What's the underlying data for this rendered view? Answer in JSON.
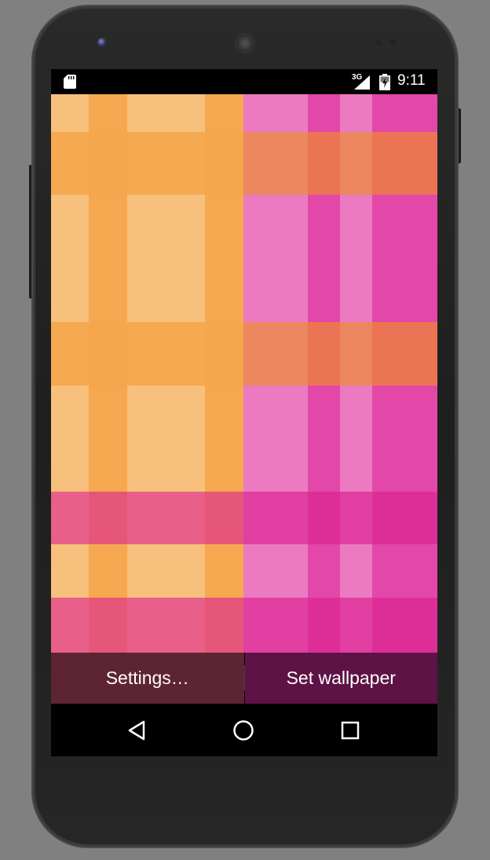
{
  "status_bar": {
    "network": "3G",
    "time": "9:11",
    "icons": [
      "sd-card-icon",
      "signal-icon",
      "battery-icon"
    ]
  },
  "wallpaper": {
    "colors": {
      "orange_light": "#f7c07d",
      "orange": "#f4a64b",
      "orange_dark": "#f29a2e",
      "pink_light": "#ec7ac0",
      "pink": "#e347a8",
      "coral": "#ec8760",
      "rose": "#e8608a",
      "magenta": "#dd2e98"
    }
  },
  "actions": {
    "settings_label": "Settings…",
    "set_wallpaper_label": "Set wallpaper"
  },
  "nav_bar": {
    "icons": [
      "back-icon",
      "home-icon",
      "recents-icon"
    ]
  }
}
